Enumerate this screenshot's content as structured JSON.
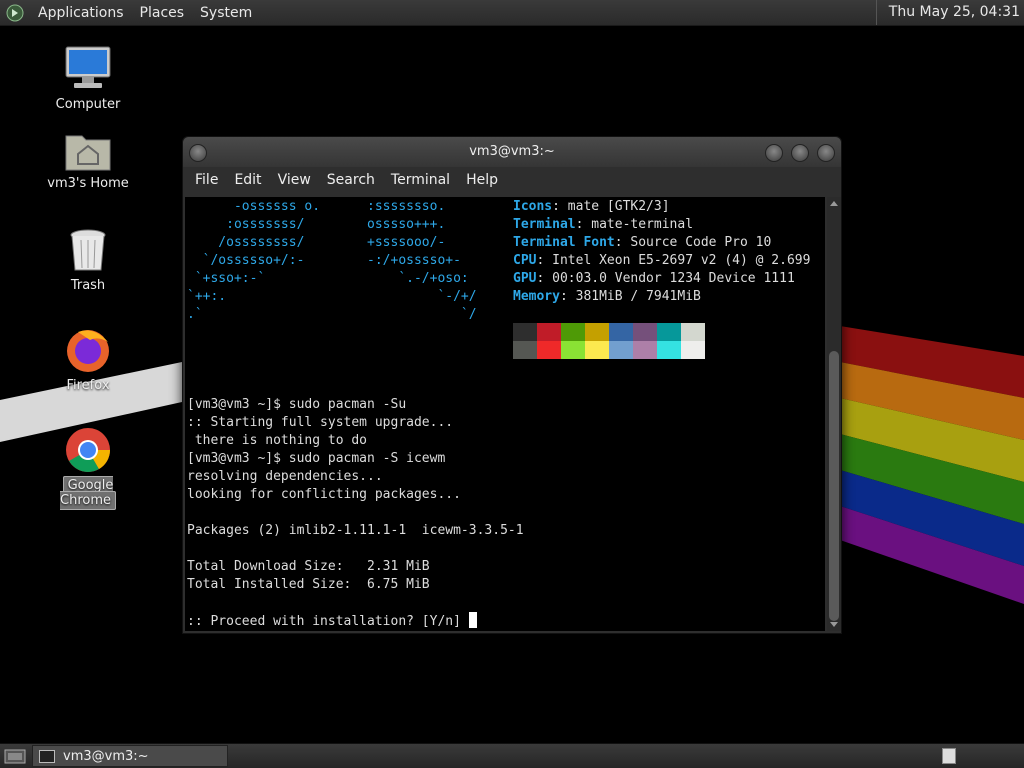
{
  "top_panel": {
    "menus": [
      "Applications",
      "Places",
      "System"
    ],
    "clock": "Thu May 25, 04:31"
  },
  "desktop_icons": [
    {
      "label": "Computer",
      "icon": "computer-icon"
    },
    {
      "label": "vm3's Home",
      "icon": "home-folder-icon"
    },
    {
      "label": "Trash",
      "icon": "trash-icon"
    },
    {
      "label": "Firefox",
      "icon": "firefox-icon"
    },
    {
      "label": "Google Chrome",
      "icon": "chrome-icon"
    }
  ],
  "terminal": {
    "title": "vm3@vm3:~",
    "menu": [
      "File",
      "Edit",
      "View",
      "Search",
      "Terminal",
      "Help"
    ],
    "ascii_art": [
      "      -ossssss o.      :ssssssso.",
      "     :osssssss/        osssso+++.",
      "    /ossssssss/        +ssssooo/-",
      "  `/ossssso+/:-        -:/+osssso+-",
      " `+sso+:-`                 `.-/+oso:",
      "`++:.                           `-/+/",
      ".`                                 `/"
    ],
    "info": [
      {
        "key": "Icons",
        "value": ": mate [GTK2/3]"
      },
      {
        "key": "Terminal",
        "value": ": mate-terminal"
      },
      {
        "key": "Terminal Font",
        "value": ": Source Code Pro 10"
      },
      {
        "key": "CPU",
        "value": ": Intel Xeon E5-2697 v2 (4) @ 2.699"
      },
      {
        "key": "GPU",
        "value": ": 00:03.0 Vendor 1234 Device 1111"
      },
      {
        "key": "Memory",
        "value": ": 381MiB / 7941MiB"
      }
    ],
    "palette_row1": [
      "#2e2e2e",
      "#c01c28",
      "#4e9a06",
      "#c4a000",
      "#3465a4",
      "#75507b",
      "#06989a",
      "#d3d7cf"
    ],
    "palette_row2": [
      "#555753",
      "#ef2929",
      "#8ae234",
      "#fce94f",
      "#729fcf",
      "#ad7fa8",
      "#34e2e2",
      "#eeeeec"
    ],
    "lines": [
      "[vm3@vm3 ~]$ sudo pacman -Su",
      ":: Starting full system upgrade...",
      " there is nothing to do",
      "[vm3@vm3 ~]$ sudo pacman -S icewm",
      "resolving dependencies...",
      "looking for conflicting packages...",
      "",
      "Packages (2) imlib2-1.11.1-1  icewm-3.3.5-1",
      "",
      "Total Download Size:   2.31 MiB",
      "Total Installed Size:  6.75 MiB",
      "",
      ":: Proceed with installation? [Y/n] "
    ]
  },
  "taskbar": {
    "task_label": "vm3@vm3:~"
  },
  "colors": {
    "accent": "#2ea8e8",
    "panel": "#2f2f2f"
  }
}
